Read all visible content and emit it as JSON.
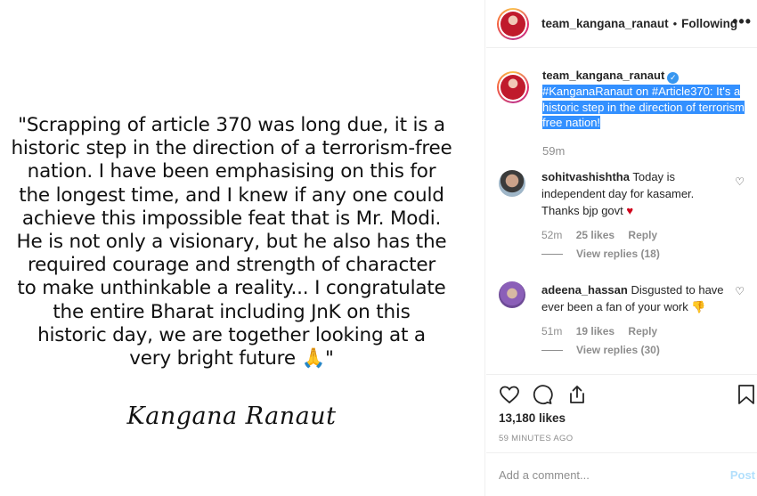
{
  "post_image": {
    "quote_lines": [
      "\"Scrapping of article 370 was long due, it is a",
      "historic step in the direction of a terrorism-free",
      "nation. I have been emphasising on this for",
      "the longest time, and I knew if any one could",
      "achieve this impossible feat that is Mr. Modi.",
      "He is not only a visionary, but he also has the",
      "required courage and strength of character",
      "to make unthinkable a reality... I congratulate",
      "the entire Bharat including JnK on this",
      "historic day, we are together looking at a",
      "very bright future 🙏\""
    ],
    "signature": "Kangana Ranaut"
  },
  "header": {
    "username": "team_kangana_ranaut",
    "separator": "•",
    "following_label": "Following",
    "more_icon": "more-options-icon"
  },
  "caption": {
    "username": "team_kangana_ranaut",
    "verified_icon": "verified-badge-icon",
    "text": "#KanganaRanaut on #Article370: It's a historic step in the direction of terrorism free nation!",
    "time": "59m"
  },
  "comments": [
    {
      "username": "sohitvashishtha",
      "text": "Today is independent day for kasamer. Thanks bjp govt",
      "emoji": "♥",
      "time": "52m",
      "likes": "25 likes",
      "reply_label": "Reply",
      "view_replies": "View replies (18)"
    },
    {
      "username": "adeena_hassan",
      "text": "Disgusted to have ever been a fan of your work",
      "emoji": "👎",
      "time": "51m",
      "likes": "19 likes",
      "reply_label": "Reply",
      "view_replies": "View replies (30)"
    }
  ],
  "actions": {
    "likes": "13,180 likes",
    "time_ago": "59 MINUTES AGO"
  },
  "add_comment": {
    "placeholder": "Add a comment...",
    "post_label": "Post"
  },
  "colors": {
    "accent_blue": "#3897f0",
    "selection_blue": "#3390ff",
    "post_disabled": "#b2dffc",
    "secondary_text": "#8e8e8e"
  }
}
